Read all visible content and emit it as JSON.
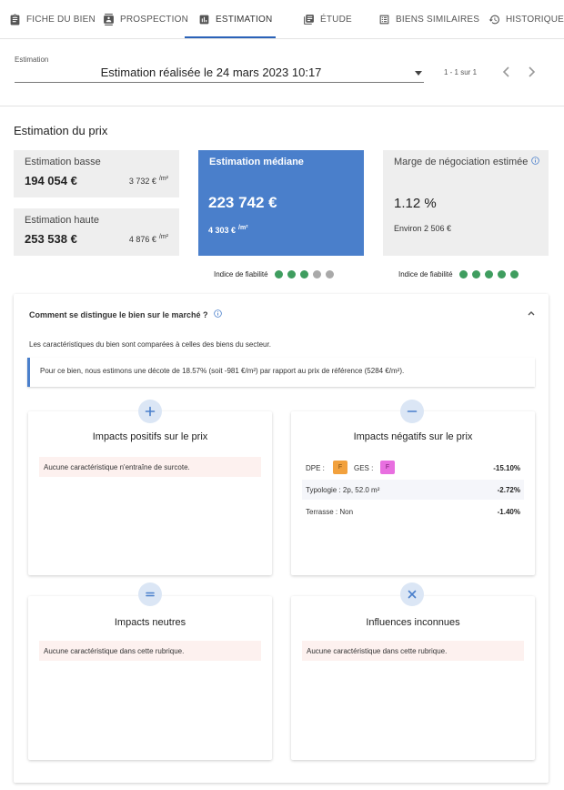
{
  "tabs": [
    {
      "label": "Fiche du bien",
      "icon": "clipboard-icon"
    },
    {
      "label": "Prospection",
      "icon": "contact-card-icon"
    },
    {
      "label": "Estimation",
      "icon": "bar-chart-icon",
      "active": true
    },
    {
      "label": "Étude",
      "icon": "newspaper-icon"
    },
    {
      "label": "Biens similaires",
      "icon": "list-icon"
    },
    {
      "label": "Historique",
      "icon": "history-icon"
    }
  ],
  "selector": {
    "label": "Estimation",
    "value": "Estimation réalisée le 24 mars 2023 10:17",
    "pager": "1 - 1 sur 1"
  },
  "price": {
    "section_title": "Estimation du prix",
    "low": {
      "title": "Estimation basse",
      "price": "194 054 €",
      "per_sqm": "3 732 €",
      "unit": "/m²"
    },
    "high": {
      "title": "Estimation haute",
      "price": "253 538 €",
      "per_sqm": "4 876 €",
      "unit": "/m²"
    },
    "median": {
      "title": "Estimation médiane",
      "price": "223 742 €",
      "per_sqm": "4 303 €",
      "unit": "/m²"
    },
    "margin": {
      "title": "Marge de négociation estimée",
      "value": "1.12 %",
      "sub": "Environ 2 506 €"
    },
    "reliability": [
      {
        "label": "Indice de fiabilité",
        "score": 3,
        "max": 5
      },
      {
        "label": "Indice de fiabilité",
        "score": 5,
        "max": 5
      }
    ]
  },
  "colors": {
    "accent": "#4a7fcb",
    "tab_underline": "#2a62b8",
    "dot_on": "#3f9d5f",
    "dot_off": "#a9a9a9",
    "dpe": "#f2a13d",
    "ges": "#e86fe0"
  },
  "market": {
    "title": "Comment se distingue le bien sur le marché ?",
    "description": "Les caractéristiques du bien sont comparées à celles des biens du secteur.",
    "alert": "Pour ce bien, nous estimons une décote de 18.57% (soit -981 €/m²) par rapport au prix de référence (5284 €/m²).",
    "positive": {
      "title": "Impacts positifs sur le prix",
      "empty": "Aucune caractéristique n'entraîne de surcote."
    },
    "negative": {
      "title": "Impacts négatifs sur le prix",
      "dpe_label": "DPE :",
      "dpe_value": "F",
      "ges_label": "GES :",
      "ges_value": "F",
      "energy_impact": "-15.10%",
      "rows": [
        {
          "label": "Typologie : 2p, 52.0 m²",
          "value": "-2.72%"
        },
        {
          "label": "Terrasse : Non",
          "value": "-1.40%"
        }
      ]
    },
    "neutral": {
      "title": "Impacts neutres",
      "empty": "Aucune caractéristique dans cette rubrique."
    },
    "unknown": {
      "title": "Influences inconnues",
      "empty": "Aucune caractéristique dans cette rubrique."
    }
  }
}
